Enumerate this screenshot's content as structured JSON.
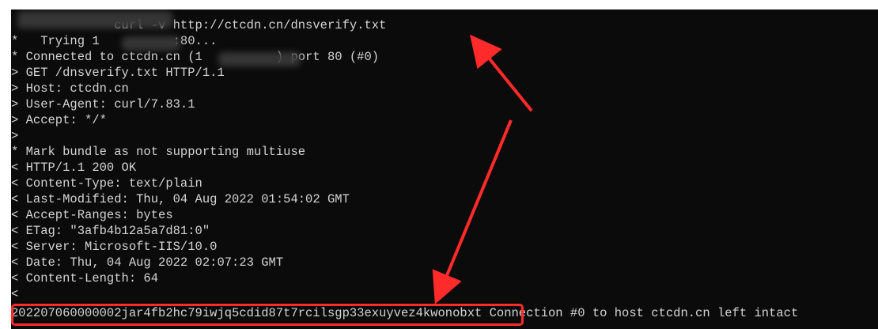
{
  "terminal": {
    "lines": [
      "              curl -v http://ctcdn.cn/dnsverify.txt",
      "*   Trying 1          :80...",
      "* Connected to ctcdn.cn (1          ) port 80 (#0)",
      "> GET /dnsverify.txt HTTP/1.1",
      "> Host: ctcdn.cn",
      "> User-Agent: curl/7.83.1",
      "> Accept: */*",
      ">",
      "* Mark bundle as not supporting multiuse",
      "< HTTP/1.1 200 OK",
      "< Content-Type: text/plain",
      "< Last-Modified: Thu, 04 Aug 2022 01:54:02 GMT",
      "< Accept-Ranges: bytes",
      "< ETag: \"3afb4b12a5a7d81:0\"",
      "< Server: Microsoft-IIS/10.0",
      "< Date: Thu, 04 Aug 2022 02:07:23 GMT",
      "< Content-Length: 64",
      "<"
    ],
    "token": "202207060000002jar4fb2hc79iwjq5cdid87t7rcilsgp33exuyvez4kwonobxt",
    "trailing": " Connection #0 to host ctcdn.cn left intact"
  },
  "colors": {
    "background": "#0b0b0b",
    "text": "#d4d4d4",
    "annotation": "#ff2a2a"
  }
}
